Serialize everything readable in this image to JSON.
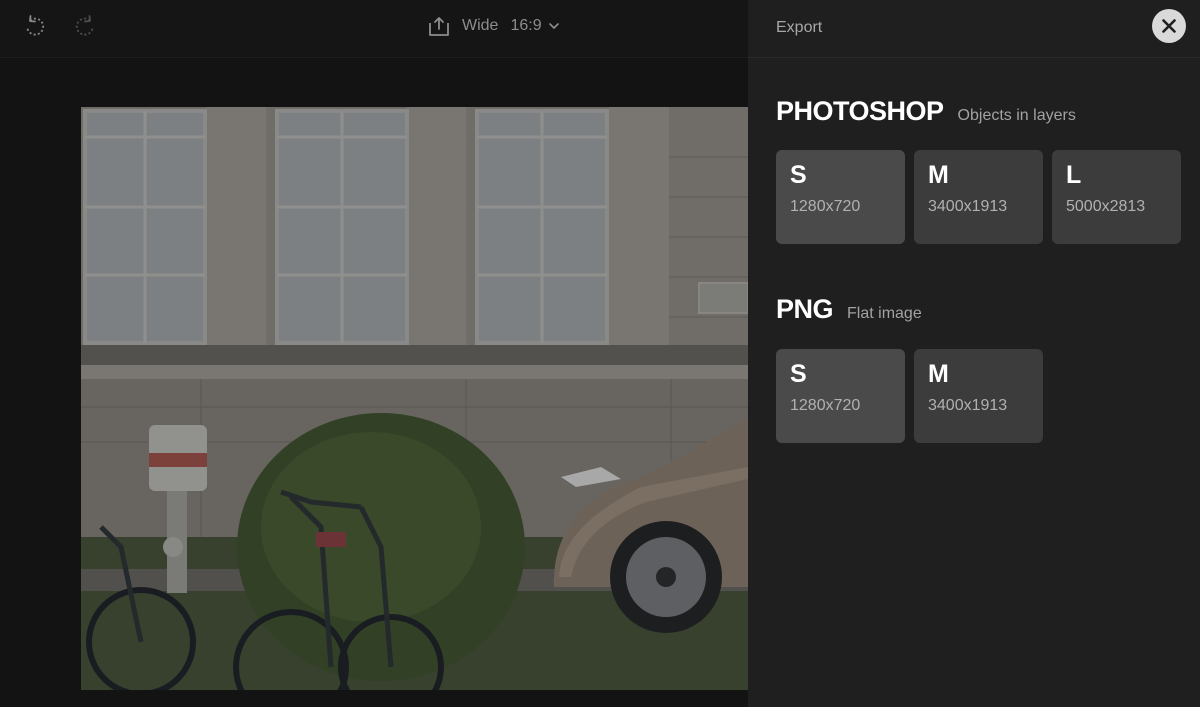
{
  "toolbar": {
    "undo_icon": "undo-icon",
    "redo_icon": "redo-icon",
    "aspect_label": "Wide",
    "aspect_ratio": "16:9"
  },
  "canvas": {
    "image_subject": "bicycles, car and hedge in front of a building"
  },
  "export_panel": {
    "title": "Export",
    "close_icon": "close-icon",
    "photoshop": {
      "title": "PHOTOSHOP",
      "subtitle": "Objects in layers",
      "options": [
        {
          "size": "S",
          "dims": "1280x720"
        },
        {
          "size": "M",
          "dims": "3400x1913"
        },
        {
          "size": "L",
          "dims": "5000x2813"
        }
      ]
    },
    "png": {
      "title": "PNG",
      "subtitle": "Flat image",
      "options": [
        {
          "size": "S",
          "dims": "1280x720"
        },
        {
          "size": "M",
          "dims": "3400x1913"
        }
      ]
    }
  },
  "colors": {
    "panel_bg": "#1f1f1f",
    "card_bg": "#3c3c3c",
    "card_selected_bg": "#4a4a4a",
    "text_primary": "#ffffff",
    "text_secondary": "#a2a2a2"
  }
}
